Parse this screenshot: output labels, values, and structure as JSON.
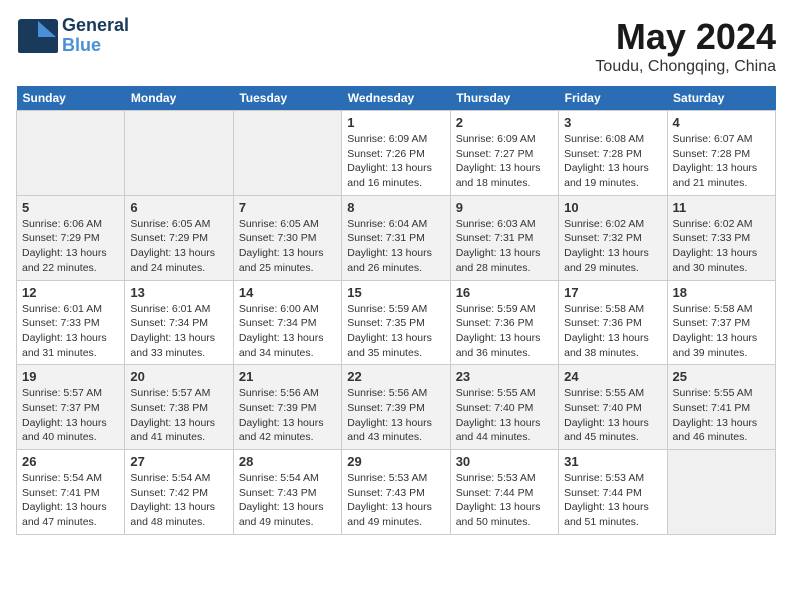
{
  "app": {
    "logo_line1": "General",
    "logo_line2": "Blue",
    "title": "May 2024",
    "subtitle": "Toudu, Chongqing, China"
  },
  "calendar": {
    "headers": [
      "Sunday",
      "Monday",
      "Tuesday",
      "Wednesday",
      "Thursday",
      "Friday",
      "Saturday"
    ],
    "weeks": [
      [
        {
          "day": "",
          "text": ""
        },
        {
          "day": "",
          "text": ""
        },
        {
          "day": "",
          "text": ""
        },
        {
          "day": "1",
          "text": "Sunrise: 6:09 AM\nSunset: 7:26 PM\nDaylight: 13 hours and 16 minutes."
        },
        {
          "day": "2",
          "text": "Sunrise: 6:09 AM\nSunset: 7:27 PM\nDaylight: 13 hours and 18 minutes."
        },
        {
          "day": "3",
          "text": "Sunrise: 6:08 AM\nSunset: 7:28 PM\nDaylight: 13 hours and 19 minutes."
        },
        {
          "day": "4",
          "text": "Sunrise: 6:07 AM\nSunset: 7:28 PM\nDaylight: 13 hours and 21 minutes."
        }
      ],
      [
        {
          "day": "5",
          "text": "Sunrise: 6:06 AM\nSunset: 7:29 PM\nDaylight: 13 hours and 22 minutes."
        },
        {
          "day": "6",
          "text": "Sunrise: 6:05 AM\nSunset: 7:29 PM\nDaylight: 13 hours and 24 minutes."
        },
        {
          "day": "7",
          "text": "Sunrise: 6:05 AM\nSunset: 7:30 PM\nDaylight: 13 hours and 25 minutes."
        },
        {
          "day": "8",
          "text": "Sunrise: 6:04 AM\nSunset: 7:31 PM\nDaylight: 13 hours and 26 minutes."
        },
        {
          "day": "9",
          "text": "Sunrise: 6:03 AM\nSunset: 7:31 PM\nDaylight: 13 hours and 28 minutes."
        },
        {
          "day": "10",
          "text": "Sunrise: 6:02 AM\nSunset: 7:32 PM\nDaylight: 13 hours and 29 minutes."
        },
        {
          "day": "11",
          "text": "Sunrise: 6:02 AM\nSunset: 7:33 PM\nDaylight: 13 hours and 30 minutes."
        }
      ],
      [
        {
          "day": "12",
          "text": "Sunrise: 6:01 AM\nSunset: 7:33 PM\nDaylight: 13 hours and 31 minutes."
        },
        {
          "day": "13",
          "text": "Sunrise: 6:01 AM\nSunset: 7:34 PM\nDaylight: 13 hours and 33 minutes."
        },
        {
          "day": "14",
          "text": "Sunrise: 6:00 AM\nSunset: 7:34 PM\nDaylight: 13 hours and 34 minutes."
        },
        {
          "day": "15",
          "text": "Sunrise: 5:59 AM\nSunset: 7:35 PM\nDaylight: 13 hours and 35 minutes."
        },
        {
          "day": "16",
          "text": "Sunrise: 5:59 AM\nSunset: 7:36 PM\nDaylight: 13 hours and 36 minutes."
        },
        {
          "day": "17",
          "text": "Sunrise: 5:58 AM\nSunset: 7:36 PM\nDaylight: 13 hours and 38 minutes."
        },
        {
          "day": "18",
          "text": "Sunrise: 5:58 AM\nSunset: 7:37 PM\nDaylight: 13 hours and 39 minutes."
        }
      ],
      [
        {
          "day": "19",
          "text": "Sunrise: 5:57 AM\nSunset: 7:37 PM\nDaylight: 13 hours and 40 minutes."
        },
        {
          "day": "20",
          "text": "Sunrise: 5:57 AM\nSunset: 7:38 PM\nDaylight: 13 hours and 41 minutes."
        },
        {
          "day": "21",
          "text": "Sunrise: 5:56 AM\nSunset: 7:39 PM\nDaylight: 13 hours and 42 minutes."
        },
        {
          "day": "22",
          "text": "Sunrise: 5:56 AM\nSunset: 7:39 PM\nDaylight: 13 hours and 43 minutes."
        },
        {
          "day": "23",
          "text": "Sunrise: 5:55 AM\nSunset: 7:40 PM\nDaylight: 13 hours and 44 minutes."
        },
        {
          "day": "24",
          "text": "Sunrise: 5:55 AM\nSunset: 7:40 PM\nDaylight: 13 hours and 45 minutes."
        },
        {
          "day": "25",
          "text": "Sunrise: 5:55 AM\nSunset: 7:41 PM\nDaylight: 13 hours and 46 minutes."
        }
      ],
      [
        {
          "day": "26",
          "text": "Sunrise: 5:54 AM\nSunset: 7:41 PM\nDaylight: 13 hours and 47 minutes."
        },
        {
          "day": "27",
          "text": "Sunrise: 5:54 AM\nSunset: 7:42 PM\nDaylight: 13 hours and 48 minutes."
        },
        {
          "day": "28",
          "text": "Sunrise: 5:54 AM\nSunset: 7:43 PM\nDaylight: 13 hours and 49 minutes."
        },
        {
          "day": "29",
          "text": "Sunrise: 5:53 AM\nSunset: 7:43 PM\nDaylight: 13 hours and 49 minutes."
        },
        {
          "day": "30",
          "text": "Sunrise: 5:53 AM\nSunset: 7:44 PM\nDaylight: 13 hours and 50 minutes."
        },
        {
          "day": "31",
          "text": "Sunrise: 5:53 AM\nSunset: 7:44 PM\nDaylight: 13 hours and 51 minutes."
        },
        {
          "day": "",
          "text": ""
        }
      ]
    ]
  }
}
